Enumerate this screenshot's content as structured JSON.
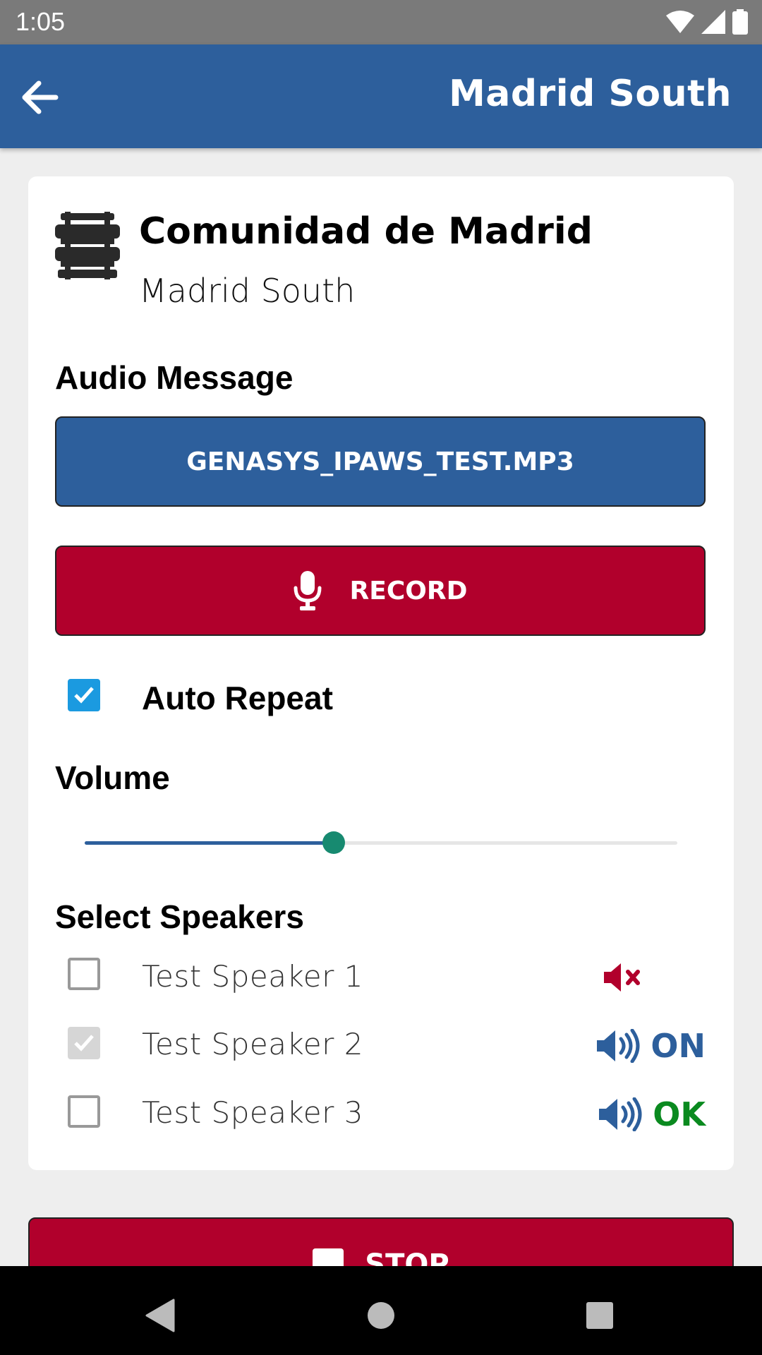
{
  "status_bar": {
    "time": "1:05"
  },
  "app_bar": {
    "title": "Madrid South"
  },
  "card": {
    "org_name": "Comunidad de Madrid",
    "org_subtitle": "Madrid South",
    "audio_message_label": "Audio Message",
    "file_button_label": "GENASYS_IPAWS_TEST.MP3",
    "record_button_label": "RECORD",
    "auto_repeat": {
      "label": "Auto Repeat",
      "checked": true
    },
    "volume": {
      "label": "Volume",
      "value_fraction": 0.42
    },
    "speakers_label": "Select Speakers",
    "speakers": [
      {
        "name": "Test Speaker 1",
        "checked": false,
        "status_icon": "speaker-muted-icon",
        "status_text": "",
        "color": "#b1002c"
      },
      {
        "name": "Test Speaker 2",
        "checked": true,
        "status_icon": "speaker-on-icon",
        "status_text": "ON",
        "color": "#2d5f9c"
      },
      {
        "name": "Test Speaker 3",
        "checked": false,
        "status_icon": "speaker-on-icon",
        "status_text": "OK",
        "color": "#0a8a1f"
      }
    ]
  },
  "stop_button_label": "STOP",
  "colors": {
    "primary": "#2d5f9c",
    "danger": "#b1002c",
    "checkbox": "#1b9ae0",
    "slider_thumb": "#178a70",
    "ok": "#0a8a1f"
  }
}
